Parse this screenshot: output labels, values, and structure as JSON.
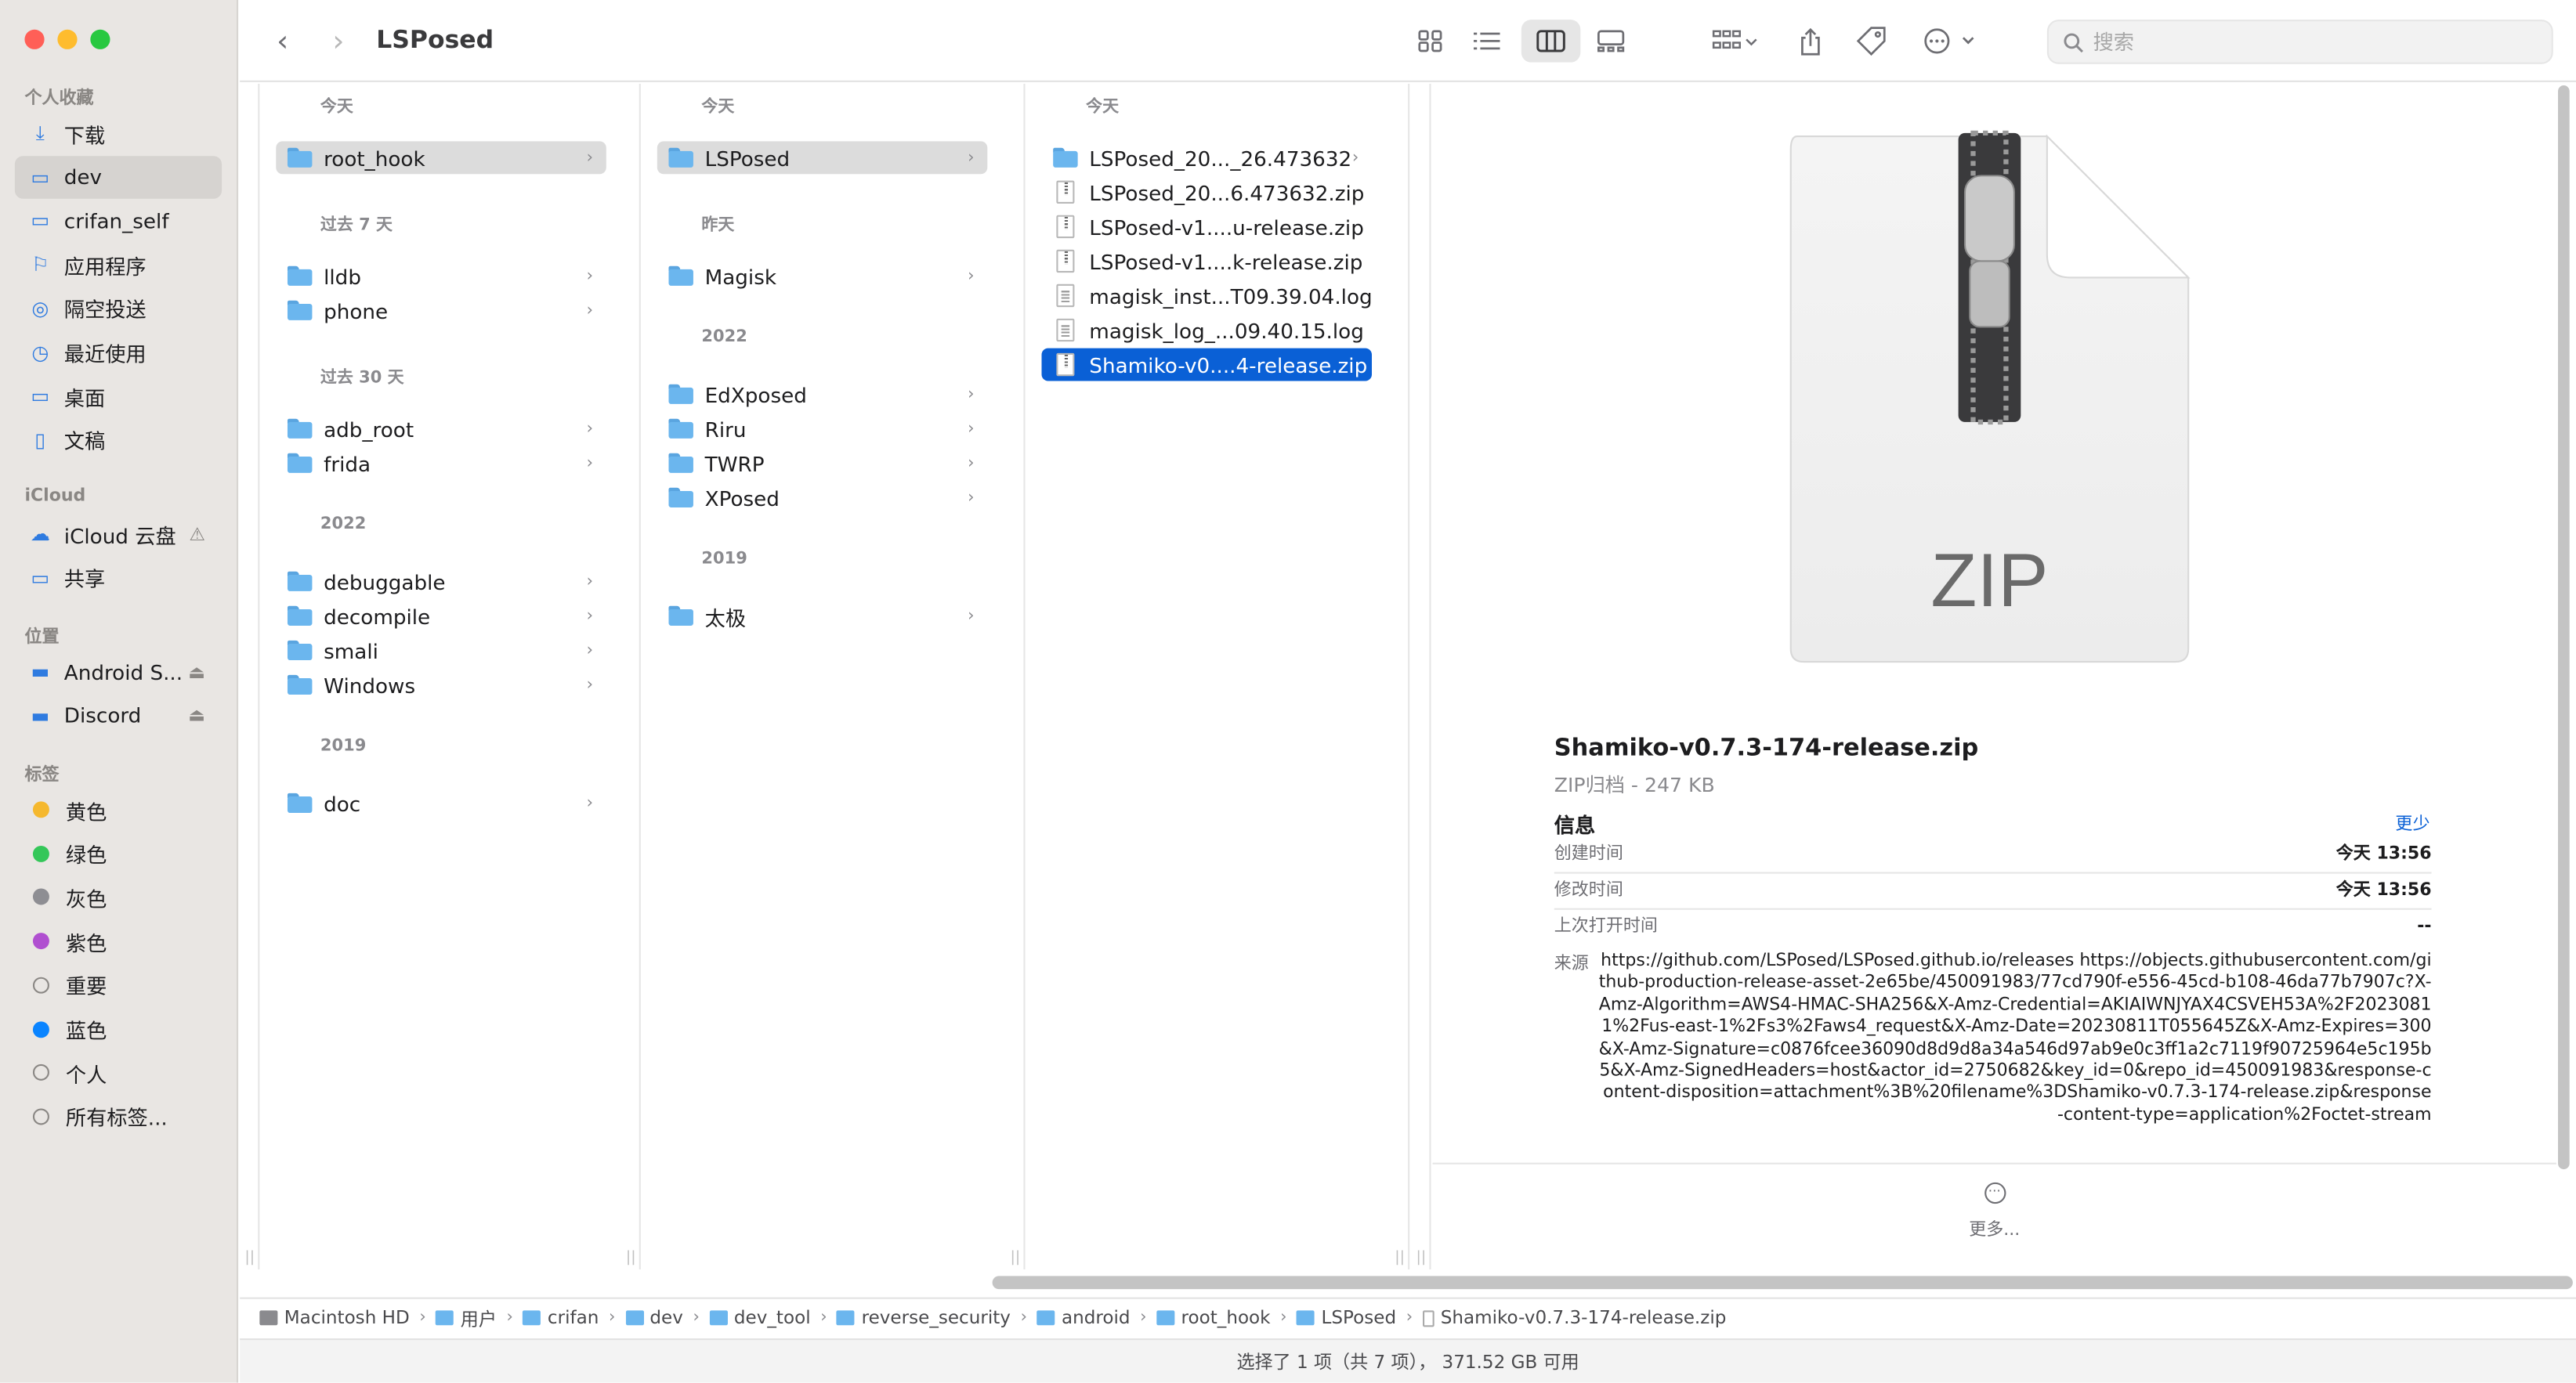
{
  "window": {
    "title": "LSPosed"
  },
  "sidebar": {
    "sections": [
      {
        "label": "个人收藏"
      },
      {
        "label": "iCloud"
      },
      {
        "label": "位置"
      },
      {
        "label": "标签"
      }
    ],
    "favorites": [
      {
        "label": "下载",
        "icon": "download-icon"
      },
      {
        "label": "dev",
        "icon": "folder-icon",
        "selected": true
      },
      {
        "label": "crifan_self",
        "icon": "folder-icon"
      },
      {
        "label": "应用程序",
        "icon": "applications-icon"
      },
      {
        "label": "隔空投送",
        "icon": "airdrop-icon"
      },
      {
        "label": "最近使用",
        "icon": "recents-icon"
      },
      {
        "label": "桌面",
        "icon": "desktop-icon"
      },
      {
        "label": "文稿",
        "icon": "document-icon"
      }
    ],
    "icloud": [
      {
        "label": "iCloud 云盘",
        "icon": "cloud-icon",
        "warning": "⚠"
      },
      {
        "label": "共享",
        "icon": "shared-folder-icon"
      }
    ],
    "locations": [
      {
        "label": "Android S...",
        "icon": "disk-icon",
        "eject": "⏏"
      },
      {
        "label": "Discord",
        "icon": "disk-icon",
        "eject": "⏏"
      }
    ],
    "tags": [
      {
        "label": "黄色",
        "color": "#f5b82e"
      },
      {
        "label": "绿色",
        "color": "#34c759"
      },
      {
        "label": "灰色",
        "color": "#8e8e93"
      },
      {
        "label": "紫色",
        "color": "#b04fd0"
      },
      {
        "label": "重要",
        "color": ""
      },
      {
        "label": "蓝色",
        "color": "#0a84ff"
      },
      {
        "label": "个人",
        "color": ""
      },
      {
        "label": "所有标签...",
        "color": ""
      }
    ]
  },
  "search": {
    "placeholder": "搜索"
  },
  "columns": {
    "col1": {
      "groups": [
        {
          "header": "今天",
          "items": [
            "root_hook"
          ]
        },
        {
          "header": "过去 7 天",
          "items": [
            "lldb",
            "phone"
          ]
        },
        {
          "header": "过去 30 天",
          "items": [
            "adb_root",
            "frida"
          ]
        },
        {
          "header": "2022",
          "items": [
            "debuggable",
            "decompile",
            "smali",
            "Windows"
          ]
        },
        {
          "header": "2019",
          "items": [
            "doc"
          ]
        }
      ],
      "selected": "root_hook"
    },
    "col2": {
      "groups": [
        {
          "header": "今天",
          "items": [
            "LSPosed"
          ]
        },
        {
          "header": "昨天",
          "items": [
            "Magisk"
          ]
        },
        {
          "header": "2022",
          "items": [
            "EdXposed",
            "Riru",
            "TWRP",
            "XPosed"
          ]
        },
        {
          "header": "2019",
          "items": [
            "太极"
          ]
        }
      ],
      "selected": "LSPosed"
    },
    "col3": {
      "header": "今天",
      "items": [
        {
          "name": "LSPosed_20..._26.473632",
          "kind": "folder"
        },
        {
          "name": "LSPosed_20...6.473632.zip",
          "kind": "zip"
        },
        {
          "name": "LSPosed-v1....u-release.zip",
          "kind": "zip"
        },
        {
          "name": "LSPosed-v1....k-release.zip",
          "kind": "zip"
        },
        {
          "name": "magisk_inst...T09.39.04.log",
          "kind": "log"
        },
        {
          "name": "magisk_log_...09.40.15.log",
          "kind": "log"
        },
        {
          "name": "Shamiko-v0....4-release.zip",
          "kind": "zip"
        }
      ],
      "selected": "Shamiko-v0....4-release.zip"
    }
  },
  "preview": {
    "icon_label": "ZIP",
    "filename": "Shamiko-v0.7.3-174-release.zip",
    "kind_size": "ZIP归档 - 247 KB",
    "info_label": "信息",
    "less_label": "更少",
    "created_label": "创建时间",
    "created_value": "今天 13:56",
    "modified_label": "修改时间",
    "modified_value": "今天 13:56",
    "opened_label": "上次打开时间",
    "opened_value": "--",
    "source_label": "来源",
    "source_value": "https://github.com/LSPosed/LSPosed.github.io/releases https://objects.githubusercontent.com/github-production-release-asset-2e65be/450091983/77cd790f-e556-45cd-b108-46da77b7907c?X-Amz-Algorithm=AWS4-HMAC-SHA256&X-Amz-Credential=AKIAIWNJYAX4CSVEH53A%2F20230811%2Fus-east-1%2Fs3%2Faws4_request&X-Amz-Date=20230811T055645Z&X-Amz-Expires=300&X-Amz-Signature=c0876fcee36090d8d9d8a34a546d97ab9e0c3ff1a2c7119f90725964e5c195b5&X-Amz-SignedHeaders=host&actor_id=2750682&key_id=0&repo_id=450091983&response-content-disposition=attachment%3B%20filename%3DShamiko-v0.7.3-174-release.zip&response-content-type=application%2Foctet-stream",
    "more_label": "更多..."
  },
  "pathbar": [
    "Macintosh HD",
    "用户",
    "crifan",
    "dev",
    "dev_tool",
    "reverse_security",
    "android",
    "root_hook",
    "LSPosed",
    "Shamiko-v0.7.3-174-release.zip"
  ],
  "status": "选择了 1 项（共 7 项）， 371.52 GB 可用",
  "colors": {
    "accent": "#0a60d6",
    "folder": "#6bb6ee",
    "sidebar_bg": "#e9e6e3"
  }
}
